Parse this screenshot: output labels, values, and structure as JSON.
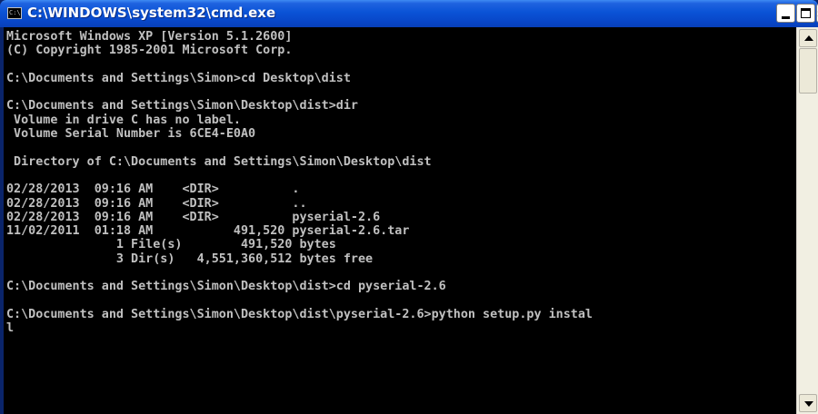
{
  "window": {
    "title": "C:\\WINDOWS\\system32\\cmd.exe",
    "icon": "cmd-icon",
    "icon_text": "C:\\",
    "controls": {
      "minimize": "minimize-icon",
      "maximize": "maximize-icon",
      "close_glyph": "×"
    }
  },
  "console": {
    "lines": [
      "Microsoft Windows XP [Version 5.1.2600]",
      "(C) Copyright 1985-2001 Microsoft Corp.",
      "",
      "C:\\Documents and Settings\\Simon>cd Desktop\\dist",
      "",
      "C:\\Documents and Settings\\Simon\\Desktop\\dist>dir",
      " Volume in drive C has no label.",
      " Volume Serial Number is 6CE4-E0A0",
      "",
      " Directory of C:\\Documents and Settings\\Simon\\Desktop\\dist",
      "",
      "02/28/2013  09:16 AM    <DIR>          .",
      "02/28/2013  09:16 AM    <DIR>          ..",
      "02/28/2013  09:16 AM    <DIR>          pyserial-2.6",
      "11/02/2011  01:18 AM           491,520 pyserial-2.6.tar",
      "               1 File(s)        491,520 bytes",
      "               3 Dir(s)   4,551,360,512 bytes free",
      "",
      "C:\\Documents and Settings\\Simon\\Desktop\\dist>cd pyserial-2.6",
      "",
      "C:\\Documents and Settings\\Simon\\Desktop\\dist\\pyserial-2.6>python setup.py instal",
      "l",
      "",
      "",
      "",
      "",
      ""
    ]
  },
  "colors": {
    "titlebar": "#0a53d6",
    "console_bg": "#000000",
    "console_text": "#c0c0c0",
    "scrollbar_track": "#f1efe2"
  }
}
